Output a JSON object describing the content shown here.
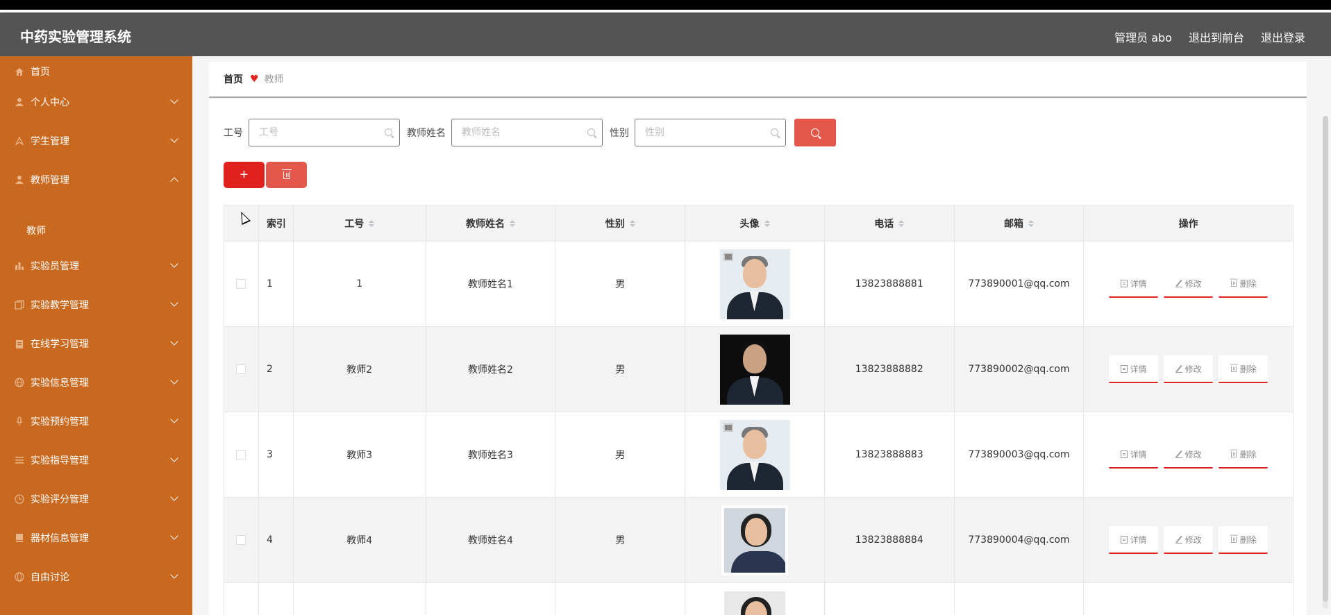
{
  "header": {
    "app_title": "中药实验管理系统",
    "user_label": "管理员 abo",
    "to_front_label": "退出到前台",
    "logout_label": "退出登录"
  },
  "sidebar": {
    "items": [
      {
        "label": "首页",
        "icon": "home-icon"
      },
      {
        "label": "个人中心",
        "icon": "user-icon"
      },
      {
        "label": "学生管理",
        "icon": "compass-icon"
      },
      {
        "label": "教师管理",
        "icon": "user-icon",
        "expanded": true
      },
      {
        "label": "实验员管理",
        "icon": "bar-chart-icon"
      },
      {
        "label": "实验教学管理",
        "icon": "copy-icon"
      },
      {
        "label": "在线学习管理",
        "icon": "clipboard-icon"
      },
      {
        "label": "实验信息管理",
        "icon": "globe-icon"
      },
      {
        "label": "实验预约管理",
        "icon": "microphone-icon"
      },
      {
        "label": "实验指导管理",
        "icon": "list-icon"
      },
      {
        "label": "实验评分管理",
        "icon": "clock-icon"
      },
      {
        "label": "器材信息管理",
        "icon": "book-icon"
      },
      {
        "label": "自由讨论",
        "icon": "globe-icon"
      }
    ],
    "sub_item": "教师"
  },
  "breadcrumb": {
    "home": "首页",
    "current": "教师"
  },
  "search": {
    "id_label": "工号",
    "id_placeholder": "工号",
    "name_label": "教师姓名",
    "name_placeholder": "教师姓名",
    "sex_label": "性别",
    "sex_placeholder": "性别"
  },
  "actions": {
    "add_symbol": "+"
  },
  "table": {
    "columns": [
      "索引",
      "工号",
      "教师姓名",
      "性别",
      "头像",
      "电话",
      "邮箱",
      "操作"
    ],
    "rows": [
      {
        "index": "1",
        "id": "1",
        "name": "教师姓名1",
        "sex": "男",
        "avatar": "man-gray-suit",
        "phone": "13823888881",
        "email": "773890001@qq.com"
      },
      {
        "index": "2",
        "id": "教师2",
        "name": "教师姓名2",
        "sex": "男",
        "avatar": "man-dark-background",
        "phone": "13823888882",
        "email": "773890002@qq.com"
      },
      {
        "index": "3",
        "id": "教师3",
        "name": "教师姓名3",
        "sex": "男",
        "avatar": "man-gray-suit",
        "phone": "13823888883",
        "email": "773890003@qq.com"
      },
      {
        "index": "4",
        "id": "教师4",
        "name": "教师姓名4",
        "sex": "男",
        "avatar": "woman-navy-suit",
        "phone": "13823888884",
        "email": "773890004@qq.com"
      }
    ],
    "ops": {
      "detail": "详情",
      "edit": "修改",
      "delete": "删除"
    }
  },
  "colors": {
    "header_bg": "#545454",
    "sidebar_bg": "#c8691f",
    "accent_red": "#e0221f",
    "button_red": "#e4574b"
  }
}
